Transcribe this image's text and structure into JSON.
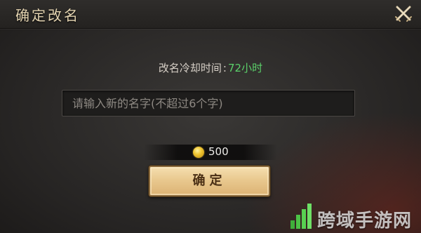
{
  "dialog": {
    "title": "确定改名"
  },
  "cooldown": {
    "label": "改名冷却时间",
    "separator": ":",
    "value": "72小时",
    "value_color": "#5bd16a"
  },
  "name_input": {
    "value": "",
    "placeholder": "请输入新的名字(不超过6个字)"
  },
  "cost": {
    "icon": "gold-coin-icon",
    "amount": "500"
  },
  "confirm_button": {
    "label": "确定"
  },
  "watermark": {
    "text": "跨域手游网"
  },
  "colors": {
    "title": "#e3d3b0",
    "button_fill": "#e9c98f",
    "button_text": "#4a2f15"
  }
}
